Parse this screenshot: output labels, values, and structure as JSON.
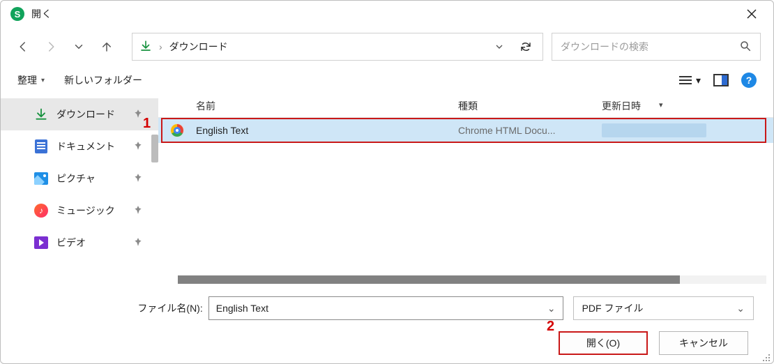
{
  "window": {
    "title": "開く"
  },
  "breadcrumb": {
    "current": "ダウンロード"
  },
  "search": {
    "placeholder": "ダウンロードの検索"
  },
  "toolbar": {
    "organize": "整理",
    "new_folder": "新しいフォルダー"
  },
  "sidebar": {
    "items": [
      {
        "label": "ダウンロード",
        "icon": "download",
        "selected": true
      },
      {
        "label": "ドキュメント",
        "icon": "doc"
      },
      {
        "label": "ピクチャ",
        "icon": "picture"
      },
      {
        "label": "ミュージック",
        "icon": "music"
      },
      {
        "label": "ビデオ",
        "icon": "video"
      }
    ]
  },
  "columns": {
    "name": "名前",
    "type": "種類",
    "date": "更新日時"
  },
  "rows": [
    {
      "name": "English Text",
      "type": "Chrome HTML Docu...",
      "date": ""
    }
  ],
  "filename": {
    "label": "ファイル名(N):",
    "value": "English Text"
  },
  "filetype": {
    "value": "PDF ファイル"
  },
  "buttons": {
    "open": "開く(O)",
    "cancel": "キャンセル"
  },
  "annotations": {
    "one": "1",
    "two": "2"
  }
}
